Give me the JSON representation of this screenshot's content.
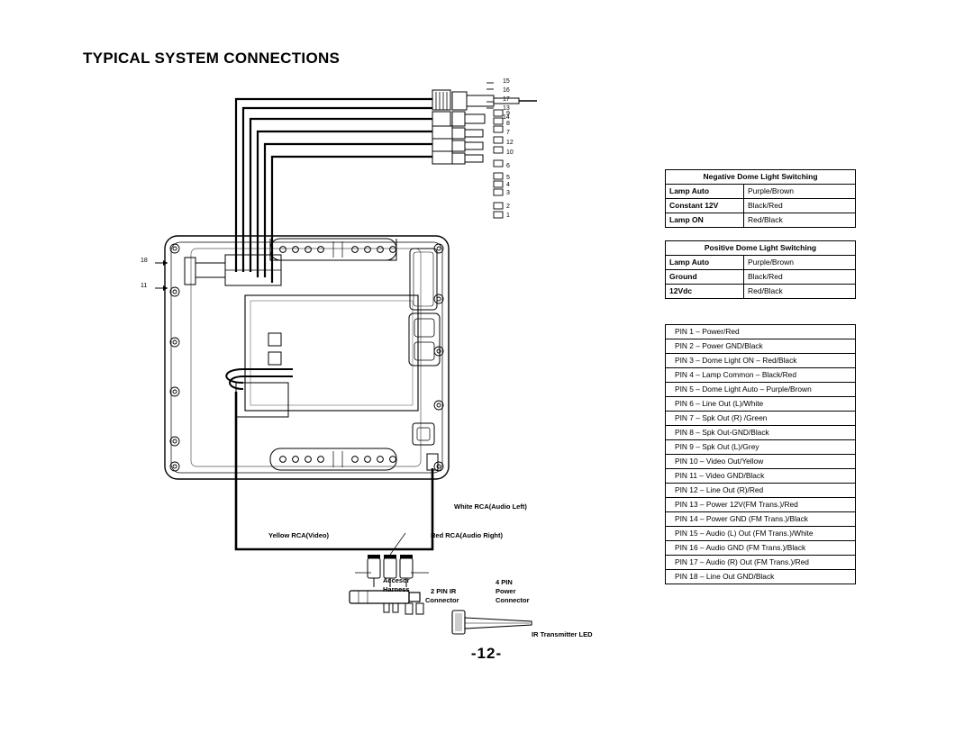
{
  "page": {
    "title": "TYPICAL SYSTEM CONNECTIONS",
    "page_number": "-12-"
  },
  "tables": {
    "negative": {
      "header": "Negative Dome Light Switching",
      "rows": [
        [
          "Lamp Auto",
          "Purple/Brown"
        ],
        [
          "Constant 12V",
          "Black/Red"
        ],
        [
          "Lamp ON",
          "Red/Black"
        ]
      ]
    },
    "positive": {
      "header": "Positive Dome Light Switching",
      "rows": [
        [
          "Lamp Auto",
          "Purple/Brown"
        ],
        [
          "Ground",
          "Black/Red"
        ],
        [
          "12Vdc",
          "Red/Black"
        ]
      ]
    },
    "pins": [
      "PIN  1 –  Power/Red",
      "PIN  2 –  Power GND/Black",
      "PIN  3 –  Dome Light ON – Red/Black",
      "PIN  4 –  Lamp Common – Black/Red",
      "PIN  5 –  Dome Light Auto – Purple/Brown",
      "PIN  6 –  Line Out (L)/White",
      "PIN  7 –  Spk Out (R) /Green",
      "PIN  8 –  Spk Out-GND/Black",
      "PIN  9 –  Spk Out (L)/Grey",
      "PIN 10 –  Video Out/Yellow",
      "PIN 11 –  Video GND/Black",
      "PIN 12 –  Line Out (R)/Red",
      "PIN 13 –  Power 12V(FM Trans.)/Red",
      "PIN 14 –  Power GND (FM Trans.)/Black",
      "PIN 15 –  Audio (L) Out (FM Trans.)/White",
      "PIN 16 –  Audio GND (FM Trans.)/Black",
      "PIN 17 –  Audio (R) Out (FM Trans.)/Red",
      "PIN 18 –  Line Out GND/Black"
    ]
  },
  "diagram": {
    "labels": {
      "white_rca": "White RCA(Audio Left)",
      "yellow_rca": "Yellow RCA(Video)",
      "red_rca": "Red RCA(Audio Right)",
      "accessor_harness_1": "Accesor",
      "accessor_harness_2": "Harness",
      "pin2_ir_1": "2 PIN IR",
      "pin2_ir_2": "Connector",
      "pin4_power_1": "4 PIN",
      "pin4_power_2": "Power",
      "pin4_power_3": "Connector",
      "ir_led": "IR Transmitter LED"
    },
    "connector_numbers_right": [
      "15",
      "16",
      "17",
      "13",
      "14"
    ],
    "connector_numbers_col": [
      "9",
      "8",
      "7",
      "12",
      "10",
      "6",
      "5",
      "4",
      "3",
      "2",
      "1"
    ],
    "connector_numbers_left": [
      "18",
      "11"
    ]
  }
}
